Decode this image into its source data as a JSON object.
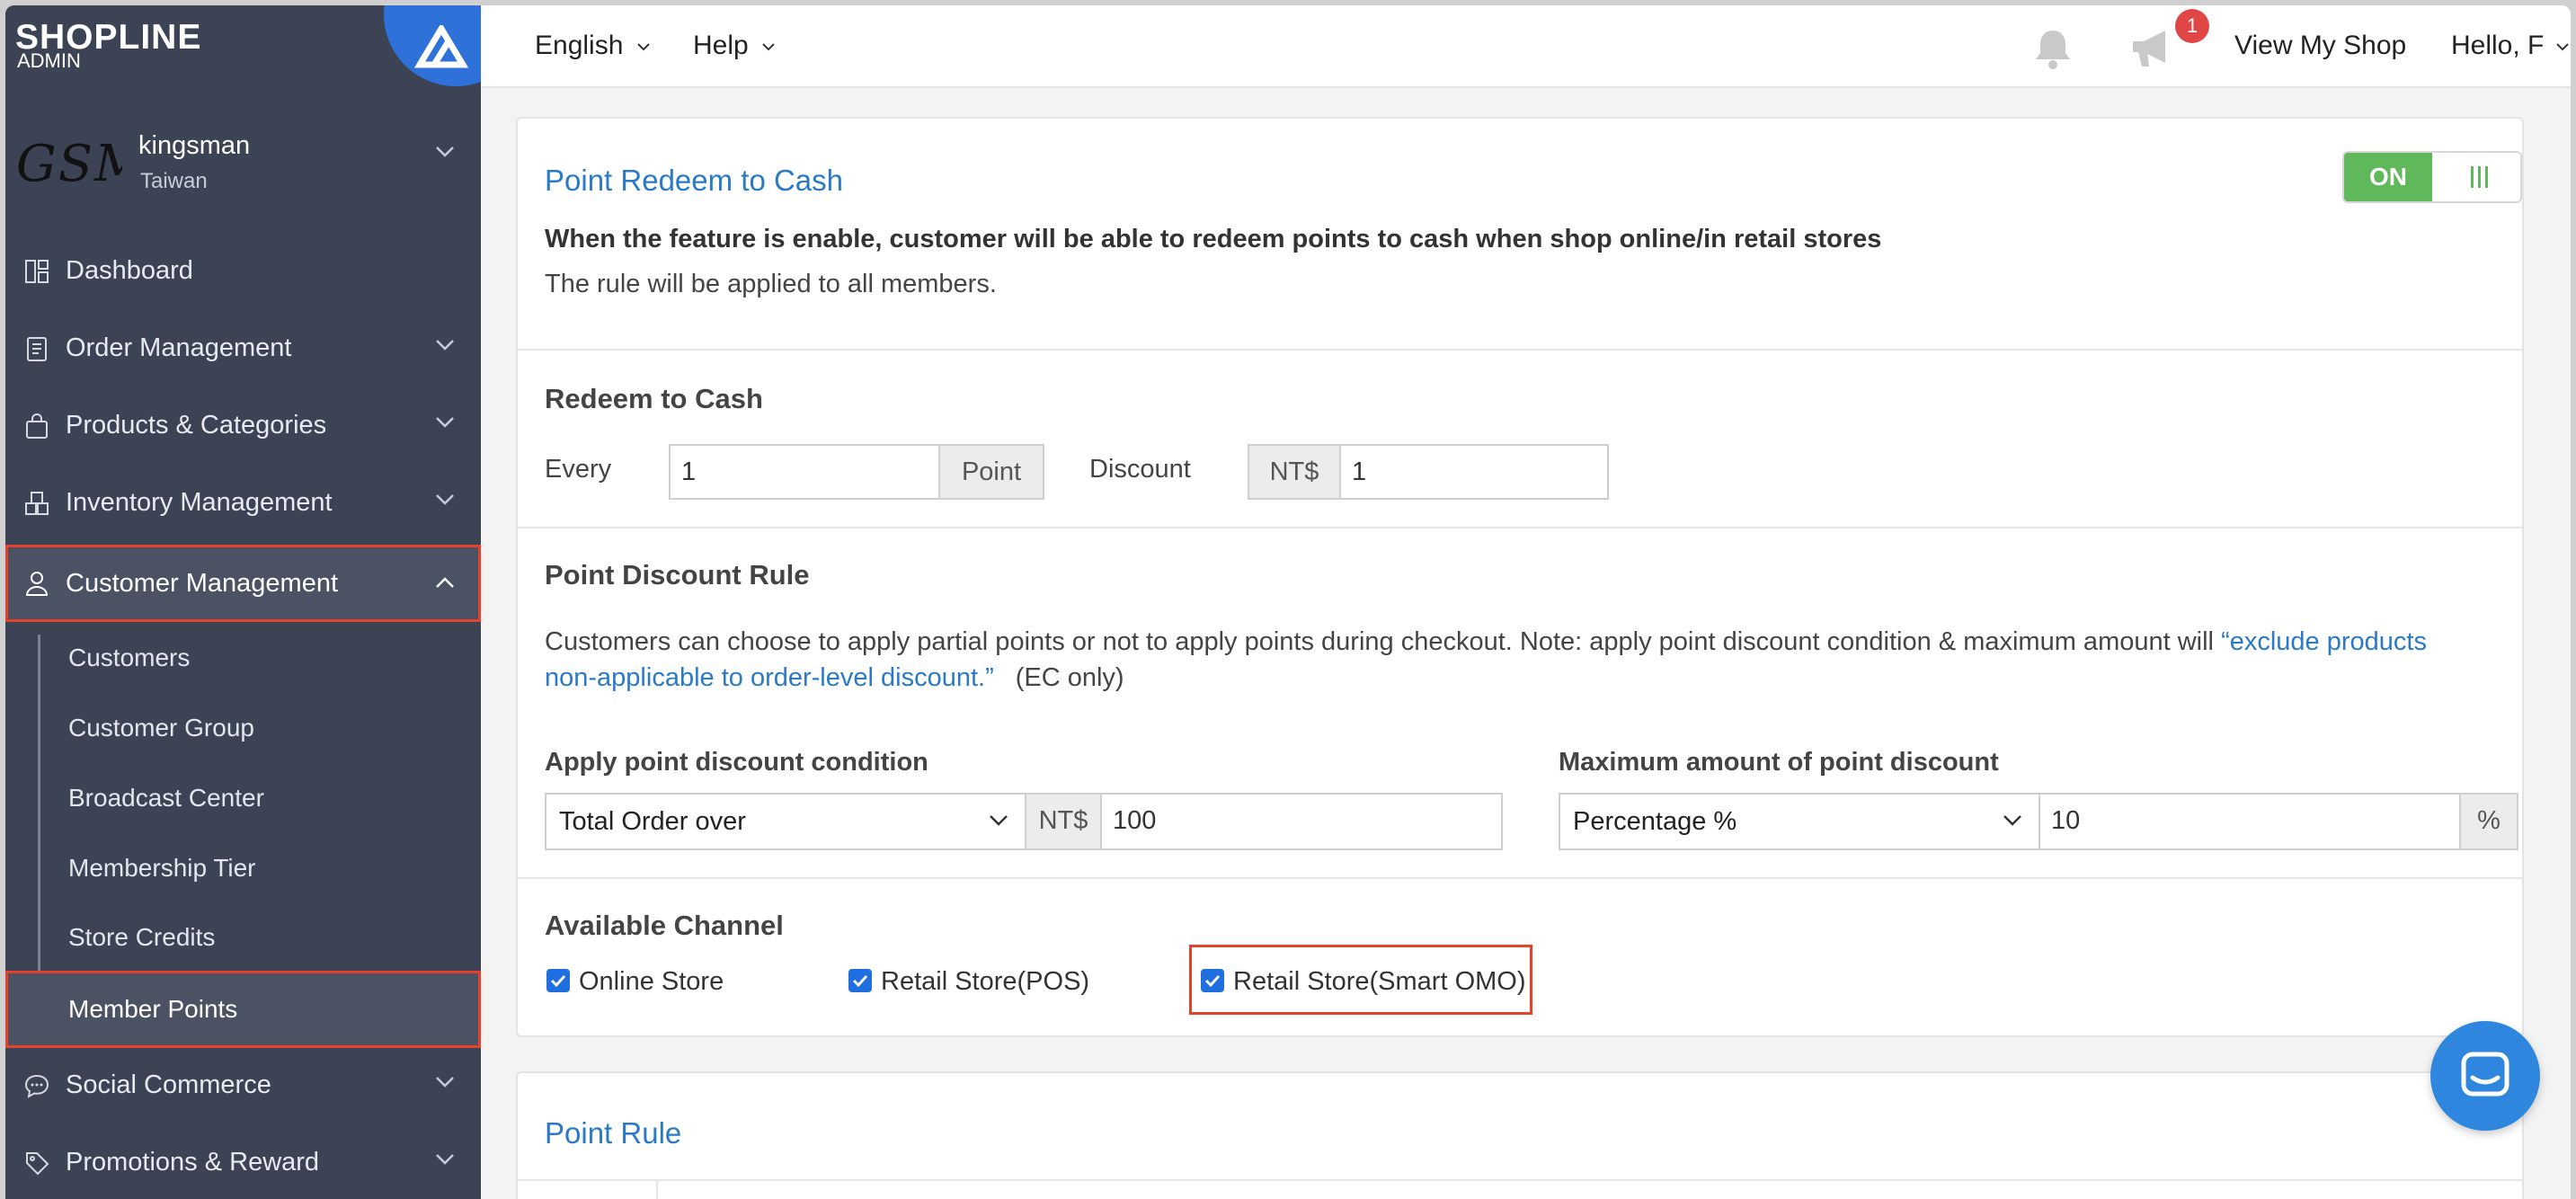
{
  "brand": {
    "name": "SHOPLINE",
    "sub": "ADMIN"
  },
  "shop": {
    "logo_text": "GSM",
    "name": "kingsman",
    "region": "Taiwan"
  },
  "sidebar": {
    "items": [
      {
        "label": "Dashboard",
        "icon": "dashboard-icon"
      },
      {
        "label": "Order Management",
        "icon": "order-icon"
      },
      {
        "label": "Products & Categories",
        "icon": "bag-icon"
      },
      {
        "label": "Inventory Management",
        "icon": "boxes-icon"
      },
      {
        "label": "Customer Management",
        "icon": "user-icon"
      },
      {
        "label": "Social Commerce",
        "icon": "chat-bubble-icon"
      },
      {
        "label": "Promotions & Reward",
        "icon": "tag-icon"
      }
    ],
    "sub_items": [
      "Customers",
      "Customer Group",
      "Broadcast Center",
      "Membership Tier",
      "Store Credits",
      "Member Points"
    ]
  },
  "topbar": {
    "language": "English",
    "help": "Help",
    "notification_count": "1",
    "view_shop": "View My Shop",
    "hello": "Hello, F"
  },
  "redeem": {
    "title": "Point Redeem to Cash",
    "toggle_on": "ON",
    "desc_bold": "When the feature is enable, customer will be able to redeem points to cash when shop online/in retail stores",
    "desc": "The rule will be applied to all members.",
    "section_title": "Redeem to Cash",
    "every_label": "Every",
    "every_value": "1",
    "point_label": "Point",
    "discount_label": "Discount",
    "currency": "NT$",
    "discount_value": "1"
  },
  "discount_rule": {
    "title": "Point Discount Rule",
    "desc_prefix": "Customers can choose to apply partial points or not to apply points during checkout. Note: apply point discount condition & maximum amount will ",
    "desc_link_1": "“exclude products",
    "desc_link_2": "non-applicable to order-level discount.”",
    "desc_suffix": "(EC only)",
    "condition_label": "Apply point discount condition",
    "condition_select": "Total Order over",
    "condition_currency": "NT$",
    "condition_value": "100",
    "max_label": "Maximum amount of point discount",
    "max_select": "Percentage %",
    "max_value": "10",
    "max_unit": "%"
  },
  "channel": {
    "title": "Available Channel",
    "options": [
      {
        "label": "Online Store",
        "checked": true
      },
      {
        "label": "Retail Store(POS)",
        "checked": true
      },
      {
        "label": "Retail Store(Smart OMO)",
        "checked": true
      }
    ]
  },
  "point_rule": {
    "title": "Point Rule"
  },
  "colors": {
    "accent": "#2a7ac8",
    "sidebar": "#3b4354",
    "toggle_on": "#5fb95a",
    "highlight": "#e5412d",
    "checkbox": "#1f6fe0"
  }
}
